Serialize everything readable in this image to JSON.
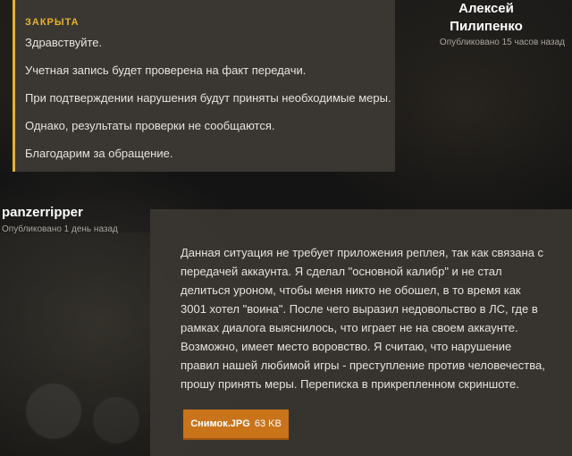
{
  "staff_post": {
    "status": "ЗАКРЫТА",
    "lines": [
      "Здравствуйте.",
      "Учетная запись будет проверена на факт передачи.",
      "При подтверждении нарушения будут приняты необходимые меры.",
      "Однако, результаты проверки не сообщаются.",
      "Благодарим за обращение."
    ],
    "author_first": "Алексей",
    "author_last": "Пилипенко",
    "published": "Опубликовано 15 часов назад",
    "accent_color": "#e7b12f"
  },
  "user_post": {
    "author": "panzerripper",
    "published": "Опубликовано 1 день назад",
    "body": "Данная ситуация не требует приложения реплея, так как связана с передачей аккаунта. Я сделал \"основной калибр\" и не стал делиться уроном, чтобы меня никто не обошел, в то время как 3001 хотел \"воина\". После чего выразил недовольство в ЛС, где в рамках диалога выяснилось, что играет не на своем аккаунте. Возможно, имеет место воровство. Я считаю, что нарушение правил нашей любимой игры - преступление против человечества, прошу принять меры. Переписка в прикрепленном скриншоте.",
    "attachment": {
      "name": "Снимок.JPG",
      "size": "63 KB",
      "color": "#c9741a"
    }
  }
}
